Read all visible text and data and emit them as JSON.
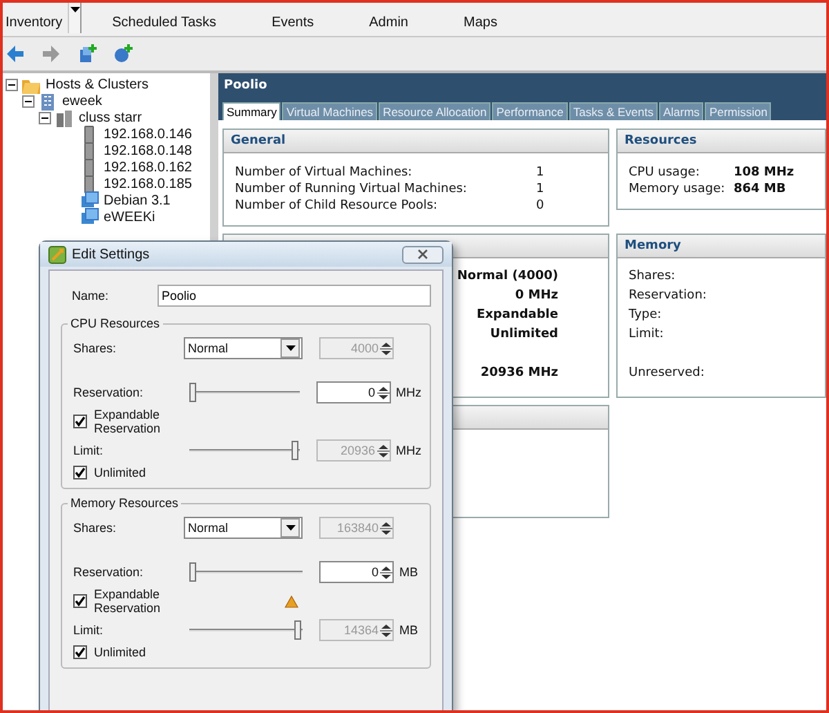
{
  "toolbar": {
    "items": [
      {
        "label": "Inventory",
        "kind": "dropdown"
      },
      {
        "label": "Scheduled Tasks",
        "kind": "button"
      },
      {
        "label": "Events",
        "kind": "button"
      },
      {
        "label": "Admin",
        "kind": "button"
      },
      {
        "label": "Maps",
        "kind": "button"
      }
    ]
  },
  "tree": {
    "items": [
      {
        "label": "Hosts & Clusters",
        "kind": "folder",
        "expanded": true,
        "children": [
          {
            "label": "eweek",
            "kind": "datacenter",
            "expanded": true,
            "children": [
              {
                "label": "cluss starr",
                "kind": "cluster",
                "expanded": true,
                "children": [
                  {
                    "label": "192.168.0.146",
                    "kind": "host"
                  },
                  {
                    "label": "192.168.0.148",
                    "kind": "host"
                  },
                  {
                    "label": "192.168.0.162",
                    "kind": "host"
                  },
                  {
                    "label": "192.168.0.185",
                    "kind": "host"
                  },
                  {
                    "label": "Debian 3.1",
                    "kind": "vm"
                  },
                  {
                    "label": "eWEEKi",
                    "kind": "vm"
                  }
                ]
              }
            ]
          }
        ]
      }
    ]
  },
  "main": {
    "title": "Poolio",
    "tabs": [
      {
        "label": "Summary",
        "selected": true
      },
      {
        "label": "Virtual Machines",
        "selected": false
      },
      {
        "label": "Resource Allocation",
        "selected": false
      },
      {
        "label": "Performance",
        "selected": false
      },
      {
        "label": "Tasks & Events",
        "selected": false
      },
      {
        "label": "Alarms",
        "selected": false
      },
      {
        "label": "Permission",
        "selected": false
      }
    ],
    "general": {
      "title": "General",
      "rows": [
        {
          "label": "Number of Virtual Machines:",
          "value": "1"
        },
        {
          "label": "Number of Running Virtual Machines:",
          "value": "1"
        },
        {
          "label": "Number of Child Resource Pools:",
          "value": "0"
        }
      ]
    },
    "resources": {
      "title": "Resources",
      "rows": [
        {
          "label": "CPU usage:",
          "value": "108 MHz"
        },
        {
          "label": "Memory usage:",
          "value": "864 MB"
        }
      ]
    },
    "cpu": {
      "rows": [
        {
          "value": "Normal (4000)",
          "kind": "line"
        },
        {
          "value": "0 MHz",
          "kind": "line"
        },
        {
          "value": "Expandable",
          "kind": "line"
        },
        {
          "value": "Unlimited",
          "kind": "line"
        },
        {
          "value": "20936 MHz",
          "kind": "total"
        }
      ]
    },
    "memory": {
      "title": "Memory",
      "rows": [
        {
          "label": "Shares:",
          "kind": "line"
        },
        {
          "label": "Reservation:",
          "kind": "line"
        },
        {
          "label": "Type:",
          "kind": "line"
        },
        {
          "label": "Limit:",
          "kind": "line"
        },
        {
          "label": "Unreserved:",
          "kind": "total"
        }
      ]
    }
  },
  "dialog": {
    "title": "Edit Settings",
    "name_label": "Name:",
    "name_value": "Poolio",
    "groups": [
      {
        "title": "CPU Resources",
        "shares_label": "Shares:",
        "shares_value": "Normal",
        "shares_number": "4000",
        "shares_number_disabled": true,
        "reservation": {
          "label": "Reservation:",
          "value": "0",
          "level": 0,
          "unit": "MHz"
        },
        "warning": false,
        "expandable_label": "Expandable Reservation",
        "expandable_checked": true,
        "limit": {
          "label": "Limit:",
          "value": "20936",
          "level": 1,
          "unit": "MHz"
        },
        "unlimited_label": "Unlimited",
        "unlimited_checked": true
      },
      {
        "title": "Memory Resources",
        "shares_label": "Shares:",
        "shares_value": "Normal",
        "shares_number": "163840",
        "shares_number_disabled": true,
        "reservation": {
          "label": "Reservation:",
          "value": "0",
          "level": 0,
          "unit": "MB"
        },
        "warning": true,
        "expandable_label": "Expandable Reservation",
        "expandable_checked": true,
        "limit": {
          "label": "Limit:",
          "value": "14364",
          "level": 1,
          "unit": "MB"
        },
        "unlimited_label": "Unlimited",
        "unlimited_checked": true
      }
    ]
  }
}
